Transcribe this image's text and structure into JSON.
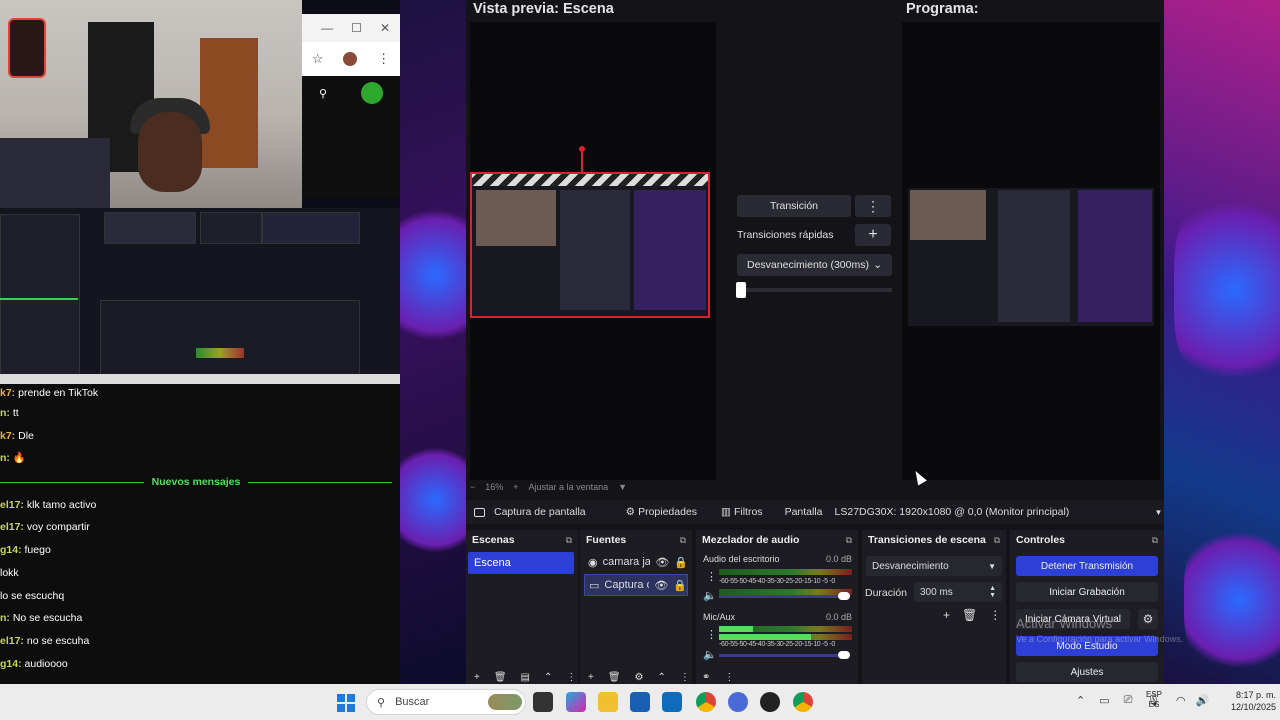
{
  "obs": {
    "preview_title": "Vista previa: Escena",
    "program_title": "Programa:",
    "zoom": {
      "minus": "−",
      "value": "16%",
      "plus": "+",
      "fit": "Ajustar a la ventana",
      "caret": "▼"
    },
    "transition": {
      "button": "Transición",
      "menu": "⋮",
      "quick_label": "Transiciones rápidas",
      "add": "+",
      "selected": "Desvanecimiento (300ms)",
      "caret": "⌄"
    },
    "source_bar": {
      "source_name": "Captura de pantalla",
      "properties": "Propiedades",
      "filters": "Filtros",
      "display_label": "Pantalla",
      "display_value": "LS27DG30X: 1920x1080 @ 0,0 (Monitor principal)",
      "caret": "▼"
    },
    "scenes": {
      "title": "Escenas",
      "items": [
        "Escena"
      ]
    },
    "sources": {
      "title": "Fuentes",
      "items": [
        "camara ja",
        "Captura d"
      ]
    },
    "mixer": {
      "title": "Mezclador de audio",
      "channels": [
        {
          "name": "Audio del escritorio",
          "level": "0.0 dB",
          "ticks": "-60-55-50-45-40-35-30-25-20-15-10 -5 -0"
        },
        {
          "name": "Mic/Aux",
          "level": "0.0 dB",
          "ticks": "-60-55-50-45-40-35-30-25-20-15-10 -5 -0"
        }
      ]
    },
    "scene_transitions": {
      "title": "Transiciones de escena",
      "type": "Desvanecimiento",
      "duration_label": "Duración",
      "duration_value": "300 ms"
    },
    "controls": {
      "title": "Controles",
      "stop_stream": "Detener Transmisión",
      "start_recording": "Iniciar Grabación",
      "start_virtual_cam": "Iniciar Cámara Virtual",
      "studio_mode": "Modo Estudio",
      "settings": "Ajustes"
    },
    "accent_color": "#2d3fd6"
  },
  "chat": {
    "new_messages": "Nuevos mensajes",
    "lines": [
      {
        "user": "k7:",
        "text": "prende en TikTok"
      },
      {
        "user": "n:",
        "text": "tt"
      },
      {
        "user": "k7:",
        "text": "Dle"
      },
      {
        "user": "n:",
        "text": "🔥"
      },
      {
        "user": "el17:",
        "text": "klk tamo activo"
      },
      {
        "user": "el17:",
        "text": "voy compartir"
      },
      {
        "user": "g14:",
        "text": "fuego"
      },
      {
        "user": "",
        "text": "lokk"
      },
      {
        "user": "",
        "text": "lo se escuchq"
      },
      {
        "user": "n:",
        "text": "No se escucha"
      },
      {
        "user": "el17:",
        "text": "no se escuha"
      },
      {
        "user": "g14:",
        "text": "audioooo"
      }
    ]
  },
  "browser_mini": {
    "min": "—",
    "max": "☐",
    "close": "✕",
    "star": "☆",
    "menu": "⋮",
    "search": "⚲"
  },
  "watermark": {
    "title": "Activar Windows",
    "subtitle": "Ve a Configuración para activar Windows."
  },
  "taskbar": {
    "search_placeholder": "Buscar",
    "lang": "ESP",
    "lang_sub": "ES",
    "time": "8:17 p. m.",
    "date": "12/10/2025"
  }
}
